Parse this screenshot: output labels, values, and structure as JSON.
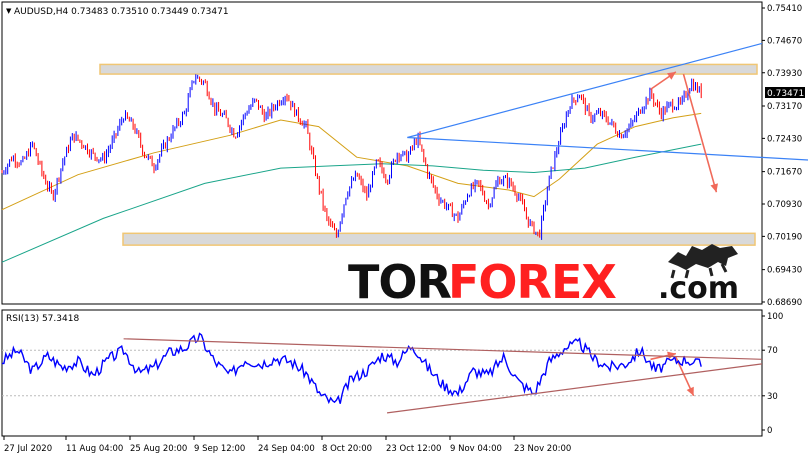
{
  "colors": {
    "bull_candle": "#0000ff",
    "bear_candle": "#ff0000",
    "ma_fast": "#d4a017",
    "ma_slow": "#1aa58a",
    "trendline": "#3b82f6",
    "zone_fill": "#d9d9d9",
    "zone_border": "#f0c674",
    "arrow": "#f06a5a",
    "rsi_line": "#0000ff",
    "rsi_channel": "#b06060",
    "price_tag_bg": "#000000",
    "price_tag_text": "#ffffff",
    "watermark_text": "#111111",
    "watermark_accent": "#ff2020"
  },
  "chart_data": [
    {
      "type": "line",
      "subtype": "candlestick",
      "title": "AUDUSD,H4  0.73483 0.73510 0.73449 0.73471",
      "symbol": "AUDUSD",
      "timeframe": "H4",
      "ohlc_header": [
        "0.73483",
        "0.73510",
        "0.73449",
        "0.73471"
      ],
      "current_price_label": "0.73471",
      "y_ticks": [
        "0.75410",
        "0.74670",
        "0.73930",
        "0.73170",
        "0.72430",
        "0.71670",
        "0.70930",
        "0.70190",
        "0.69430",
        "0.68690"
      ],
      "ylim": [
        0.6869,
        0.7541
      ],
      "x_ticks": [
        "27 Jul 2020",
        "11 Aug 04:00",
        "25 Aug 20:00",
        "9 Sep 12:00",
        "24 Sep 04:00",
        "8 Oct 20:00",
        "23 Oct 12:00",
        "9 Nov 04:00",
        "23 Nov 20:00"
      ],
      "price_path": [
        [
          0,
          0.7165
        ],
        [
          4,
          0.72
        ],
        [
          8,
          0.7185
        ],
        [
          12,
          0.723
        ],
        [
          16,
          0.716
        ],
        [
          20,
          0.711
        ],
        [
          24,
          0.719
        ],
        [
          28,
          0.725
        ],
        [
          32,
          0.723
        ],
        [
          36,
          0.7205
        ],
        [
          40,
          0.7195
        ],
        [
          44,
          0.724
        ],
        [
          48,
          0.7295
        ],
        [
          52,
          0.727
        ],
        [
          56,
          0.721
        ],
        [
          60,
          0.718
        ],
        [
          64,
          0.7225
        ],
        [
          68,
          0.7265
        ],
        [
          72,
          0.73
        ],
        [
          76,
          0.7385
        ],
        [
          80,
          0.737
        ],
        [
          84,
          0.731
        ],
        [
          88,
          0.729
        ],
        [
          92,
          0.725
        ],
        [
          96,
          0.73
        ],
        [
          100,
          0.733
        ],
        [
          104,
          0.729
        ],
        [
          108,
          0.732
        ],
        [
          112,
          0.7345
        ],
        [
          116,
          0.73
        ],
        [
          120,
          0.727
        ],
        [
          124,
          0.716
        ],
        [
          128,
          0.706
        ],
        [
          132,
          0.702
        ],
        [
          136,
          0.712
        ],
        [
          140,
          0.716
        ],
        [
          144,
          0.711
        ],
        [
          148,
          0.719
        ],
        [
          152,
          0.715
        ],
        [
          156,
          0.721
        ],
        [
          160,
          0.72
        ],
        [
          164,
          0.7245
        ],
        [
          168,
          0.7165
        ],
        [
          172,
          0.711
        ],
        [
          176,
          0.7085
        ],
        [
          180,
          0.706
        ],
        [
          184,
          0.712
        ],
        [
          188,
          0.714
        ],
        [
          192,
          0.709
        ],
        [
          196,
          0.715
        ],
        [
          200,
          0.7145
        ],
        [
          204,
          0.711
        ],
        [
          208,
          0.705
        ],
        [
          212,
          0.702
        ],
        [
          216,
          0.715
        ],
        [
          220,
          0.724
        ],
        [
          224,
          0.732
        ],
        [
          228,
          0.7345
        ],
        [
          232,
          0.729
        ],
        [
          236,
          0.73
        ],
        [
          240,
          0.728
        ],
        [
          244,
          0.725
        ],
        [
          248,
          0.727
        ],
        [
          252,
          0.731
        ],
        [
          256,
          0.7345
        ],
        [
          260,
          0.73
        ],
        [
          264,
          0.732
        ],
        [
          268,
          0.732
        ],
        [
          272,
          0.737
        ],
        [
          276,
          0.7347
        ]
      ],
      "ma_fast": [
        [
          0,
          0.708
        ],
        [
          30,
          0.716
        ],
        [
          60,
          0.721
        ],
        [
          90,
          0.725
        ],
        [
          110,
          0.7285
        ],
        [
          125,
          0.727
        ],
        [
          140,
          0.72
        ],
        [
          160,
          0.718
        ],
        [
          180,
          0.714
        ],
        [
          200,
          0.7125
        ],
        [
          210,
          0.711
        ],
        [
          220,
          0.715
        ],
        [
          235,
          0.723
        ],
        [
          250,
          0.727
        ],
        [
          265,
          0.729
        ],
        [
          276,
          0.73
        ]
      ],
      "ma_slow": [
        [
          0,
          0.696
        ],
        [
          40,
          0.706
        ],
        [
          80,
          0.714
        ],
        [
          110,
          0.7175
        ],
        [
          130,
          0.718
        ],
        [
          150,
          0.7185
        ],
        [
          170,
          0.718
        ],
        [
          190,
          0.717
        ],
        [
          210,
          0.7165
        ],
        [
          230,
          0.7175
        ],
        [
          250,
          0.72
        ],
        [
          276,
          0.723
        ]
      ],
      "zones": [
        {
          "name": "resistance",
          "from": 0.739,
          "to": 0.7412
        },
        {
          "name": "support",
          "from": 0.6999,
          "to": 0.7026
        }
      ],
      "trendlines": [
        {
          "name": "upper-rising",
          "p1": [
            160,
            0.7245
          ],
          "p2": [
            300,
            0.746
          ]
        },
        {
          "name": "lower-falling",
          "p1": [
            160,
            0.7245
          ],
          "p2": [
            360,
            0.718
          ]
        }
      ],
      "forecast_arrows": [
        {
          "name": "up",
          "from": [
            256,
            0.7355
          ],
          "to": [
            266,
            0.7395
          ]
        },
        {
          "name": "down",
          "from": [
            269,
            0.739
          ],
          "to": [
            282,
            0.712
          ]
        }
      ]
    },
    {
      "type": "line",
      "title": "RSI(13) 57.3418",
      "indicator": "RSI(13)",
      "value_label": "57.3418",
      "y_ticks": [
        "100",
        "70",
        "30",
        "0"
      ],
      "ylim": [
        0,
        100
      ],
      "levels": [
        70,
        30
      ],
      "values": [
        [
          0,
          60
        ],
        [
          6,
          70
        ],
        [
          12,
          52
        ],
        [
          18,
          65
        ],
        [
          24,
          55
        ],
        [
          30,
          60
        ],
        [
          36,
          48
        ],
        [
          42,
          62
        ],
        [
          48,
          70
        ],
        [
          54,
          50
        ],
        [
          60,
          55
        ],
        [
          66,
          68
        ],
        [
          72,
          72
        ],
        [
          78,
          82
        ],
        [
          84,
          60
        ],
        [
          90,
          48
        ],
        [
          96,
          62
        ],
        [
          102,
          58
        ],
        [
          108,
          63
        ],
        [
          114,
          60
        ],
        [
          120,
          50
        ],
        [
          126,
          30
        ],
        [
          132,
          22
        ],
        [
          138,
          45
        ],
        [
          144,
          52
        ],
        [
          150,
          66
        ],
        [
          156,
          60
        ],
        [
          162,
          75
        ],
        [
          168,
          55
        ],
        [
          174,
          40
        ],
        [
          180,
          32
        ],
        [
          186,
          52
        ],
        [
          192,
          48
        ],
        [
          198,
          64
        ],
        [
          204,
          42
        ],
        [
          210,
          32
        ],
        [
          216,
          60
        ],
        [
          222,
          72
        ],
        [
          228,
          76
        ],
        [
          234,
          62
        ],
        [
          240,
          55
        ],
        [
          246,
          58
        ],
        [
          252,
          70
        ],
        [
          258,
          52
        ],
        [
          264,
          60
        ],
        [
          270,
          62
        ],
        [
          276,
          57
        ]
      ],
      "channel": [
        {
          "name": "upper",
          "p1": [
            48,
            80
          ],
          "p2": [
            300,
            62
          ]
        },
        {
          "name": "lower",
          "p1": [
            152,
            15
          ],
          "p2": [
            300,
            58
          ]
        }
      ],
      "forecast_arrows": [
        {
          "name": "up",
          "from": [
            256,
            62
          ],
          "to": [
            266,
            67
          ]
        },
        {
          "name": "down",
          "from": [
            266,
            64
          ],
          "to": [
            273,
            30
          ]
        }
      ]
    }
  ],
  "watermark": {
    "text_a": "TOR",
    "text_b": "FOREX",
    "text_c": ".com"
  },
  "ui": {
    "collapse_arrow": "▼"
  }
}
